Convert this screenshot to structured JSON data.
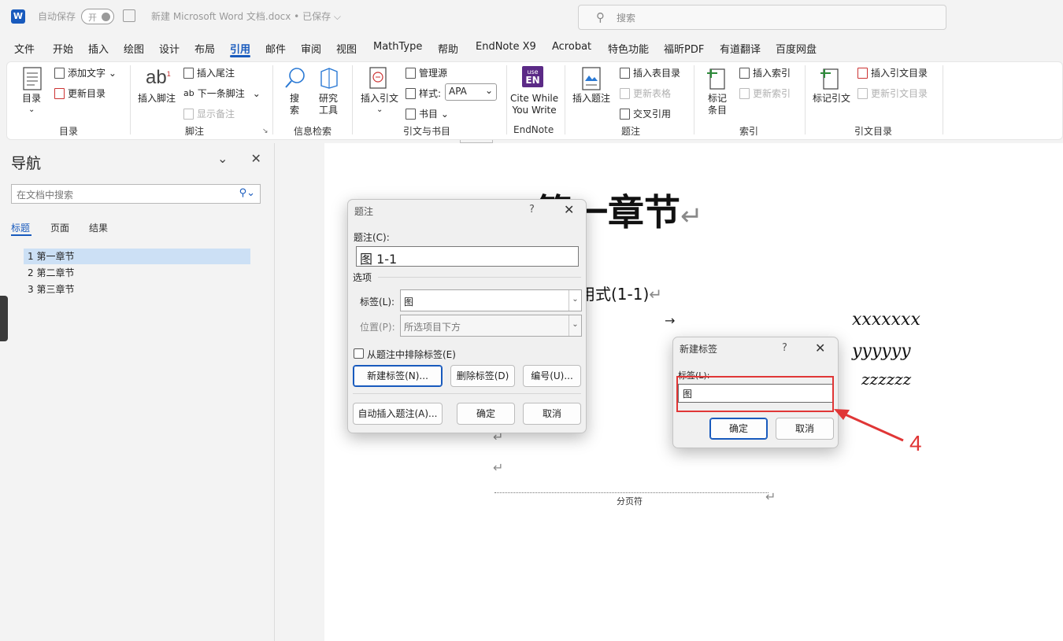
{
  "titlebar": {
    "autosave_label": "自动保存",
    "autosave_toggle": "开",
    "doc_title": "新建 Microsoft Word 文档.docx • 已保存 ⌵",
    "search_placeholder": "搜索"
  },
  "menu": [
    "文件",
    "开始",
    "插入",
    "绘图",
    "设计",
    "布局",
    "引用",
    "邮件",
    "审阅",
    "视图",
    "MathType",
    "帮助",
    "EndNote X9",
    "Acrobat",
    "特色功能",
    "福昕PDF",
    "有道翻译",
    "百度网盘"
  ],
  "menu_active": "引用",
  "ribbon": {
    "toc": {
      "big": "目录",
      "add_text": "添加文字 ⌄",
      "update": "更新目录",
      "group": "目录"
    },
    "footnotes": {
      "insert_footnote": "插入脚注",
      "insert_endnote": "插入尾注",
      "next_footnote": "下一条脚注",
      "show_notes": "显示备注",
      "group": "脚注"
    },
    "research": {
      "search_1": "搜",
      "search_2": "索",
      "researcher_1": "研究",
      "researcher_2": "工具",
      "group": "信息检索"
    },
    "citations": {
      "insert_citation": "插入引文",
      "manage_sources": "管理源",
      "style_label": "样式:",
      "style_value": "APA",
      "bibliography": "书目 ⌄",
      "group": "引文与书目"
    },
    "endnote": {
      "line1": "Cite While",
      "line2": "You Write",
      "logo_top": "use",
      "logo_bottom": "EN",
      "group": "EndNote"
    },
    "captions": {
      "insert_caption": "插入题注",
      "insert_tof": "插入表目录",
      "update_table": "更新表格",
      "cross_ref": "交叉引用",
      "group": "题注"
    },
    "index": {
      "mark_1": "标记",
      "mark_2": "条目",
      "insert_index": "插入索引",
      "update_index": "更新索引",
      "group": "索引"
    },
    "toa": {
      "mark_citation": "标记引文",
      "insert_toa": "插入引文目录",
      "update_toa": "更新引文目录",
      "group": "引文目录"
    }
  },
  "nav": {
    "title": "导航",
    "search_placeholder": "在文档中搜索",
    "tabs": [
      "标题",
      "页面",
      "结果"
    ],
    "headings": [
      "1 第一章节",
      "2 第二章节",
      "3 第三章节"
    ]
  },
  "document": {
    "heading": "第一章节",
    "formula_text": "用式(1-1)",
    "vars": [
      "xxxxxxx",
      "yyyyyy",
      "zzzzzz"
    ],
    "page_break": "分页符",
    "para_mark": "↵"
  },
  "caption_dialog": {
    "title": "题注",
    "caption_label": "题注(C):",
    "caption_value": "图  1-1",
    "options_label": "选项",
    "label_label": "标签(L):",
    "label_value": "图",
    "position_label": "位置(P):",
    "position_value": "所选项目下方",
    "exclude_label": "从题注中排除标签(E)",
    "btn_new_label": "新建标签(N)...",
    "btn_delete_label": "删除标签(D)",
    "btn_numbering": "编号(U)...",
    "btn_autocaption": "自动插入题注(A)...",
    "btn_ok": "确定",
    "btn_cancel": "取消"
  },
  "new_label_dialog": {
    "title": "新建标签",
    "label_label": "标签(L):",
    "label_value": "图",
    "btn_ok": "确定",
    "btn_cancel": "取消"
  },
  "annotation": {
    "number": "4",
    "color": "#e03636"
  },
  "colors": {
    "accent": "#185abd"
  }
}
